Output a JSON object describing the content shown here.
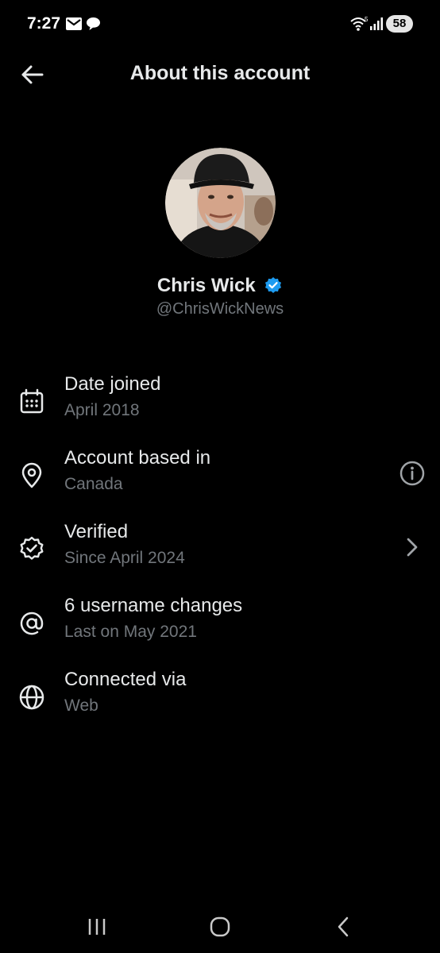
{
  "status_bar": {
    "time": "7:27",
    "battery": "58",
    "icons": [
      "mail-icon",
      "chat-bubble-icon",
      "wifi-icon",
      "signal-icon"
    ]
  },
  "header": {
    "title": "About this account",
    "back_icon": "arrow-left-icon"
  },
  "profile": {
    "name": "Chris Wick",
    "handle": "@ChrisWickNews",
    "verified": true,
    "badge_color": "#1d9bf0"
  },
  "rows": [
    {
      "icon": "calendar-icon",
      "title": "Date joined",
      "subtitle": "April 2018"
    },
    {
      "icon": "location-pin-icon",
      "title": "Account based in",
      "subtitle": "Canada",
      "action_icon": "info-icon"
    },
    {
      "icon": "verified-badge-outline-icon",
      "title": "Verified",
      "subtitle": "Since April 2024",
      "action_icon": "chevron-right-icon"
    },
    {
      "icon": "at-sign-icon",
      "title": "6 username changes",
      "subtitle": "Last on May 2021"
    },
    {
      "icon": "globe-icon",
      "title": "Connected via",
      "subtitle": "Web"
    }
  ],
  "nav_bar": {
    "buttons": [
      "recent-apps-icon",
      "home-icon",
      "back-icon"
    ]
  },
  "colors": {
    "background": "#000000",
    "primary_text": "#e7e9ea",
    "secondary_text": "#71767b",
    "accent": "#1d9bf0"
  }
}
